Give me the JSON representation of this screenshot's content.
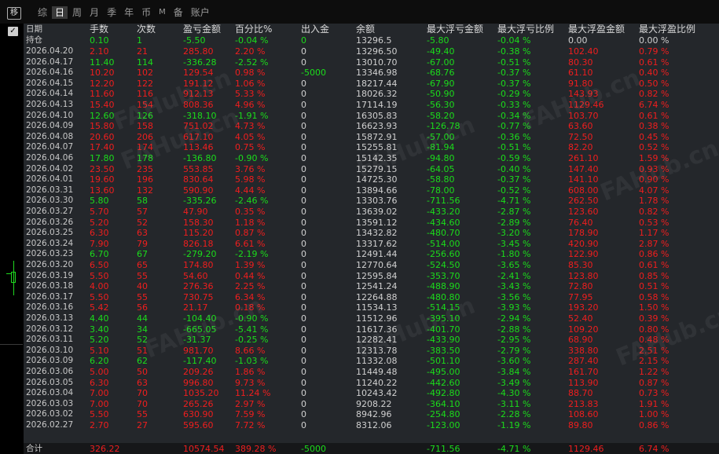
{
  "toolbar": {
    "move_icon": "移",
    "tabs": [
      "综",
      "日",
      "周",
      "月",
      "季",
      "年",
      "币",
      "M",
      "备",
      "账户"
    ],
    "active_tab": "日"
  },
  "colors": {
    "profit": "#f01e1e",
    "loss": "#1bdc1b",
    "neutral": "#d0d0d0"
  },
  "watermark": "FAHub.cn",
  "table": {
    "headers": [
      "日期",
      "手数",
      "次数",
      "盈亏金额",
      "百分比%",
      "出入金",
      "余额",
      "最大浮亏金额",
      "最大浮亏比例",
      "最大浮盈金额",
      "最大浮盈比例"
    ],
    "holding": {
      "label": "持仓",
      "v": [
        "0.10",
        "1",
        "-5.50",
        "-0.04 %",
        "0",
        "13296.5",
        "-5.80",
        "-0.04 %",
        "0.00",
        "0.00 %"
      ],
      "c": "gggggwggww"
    },
    "rows": [
      {
        "d": "2026.04.20",
        "v": [
          "2.10",
          "21",
          "285.80",
          "2.20 %",
          "0",
          "13296.50",
          "-49.40",
          "-0.38 %",
          "102.40",
          "0.79 %"
        ],
        "c": "rrrrwwggrr"
      },
      {
        "d": "2026.04.17",
        "v": [
          "11.40",
          "114",
          "-336.28",
          "-2.52 %",
          "0",
          "13010.70",
          "-67.00",
          "-0.51 %",
          "80.30",
          "0.61 %"
        ],
        "c": "ggggwwggrr"
      },
      {
        "d": "2026.04.16",
        "v": [
          "10.20",
          "102",
          "129.54",
          "0.98 %",
          "-5000",
          "13346.98",
          "-68.76",
          "-0.37 %",
          "61.10",
          "0.40 %"
        ],
        "c": "rrrrgwggrr"
      },
      {
        "d": "2026.04.15",
        "v": [
          "12.20",
          "122",
          "191.12",
          "1.06 %",
          "0",
          "18217.44",
          "-67.90",
          "-0.37 %",
          "91.80",
          "0.50 %"
        ],
        "c": "rrrrwwggrr"
      },
      {
        "d": "2026.04.14",
        "v": [
          "11.60",
          "116",
          "912.13",
          "5.33 %",
          "0",
          "18026.32",
          "-50.90",
          "-0.29 %",
          "143.93",
          "0.82 %"
        ],
        "c": "rrrrwwggrr"
      },
      {
        "d": "2026.04.13",
        "v": [
          "15.40",
          "154",
          "808.36",
          "4.96 %",
          "0",
          "17114.19",
          "-56.30",
          "-0.33 %",
          "1129.46",
          "6.74 %"
        ],
        "c": "rrrrwwggrr"
      },
      {
        "d": "2026.04.10",
        "v": [
          "12.60",
          "126",
          "-318.10",
          "-1.91 %",
          "0",
          "16305.83",
          "-58.20",
          "-0.34 %",
          "103.70",
          "0.61 %"
        ],
        "c": "ggggwwggrr"
      },
      {
        "d": "2026.04.09",
        "v": [
          "15.80",
          "158",
          "751.02",
          "4.73 %",
          "0",
          "16623.93",
          "-126.78",
          "-0.77 %",
          "63.60",
          "0.38 %"
        ],
        "c": "rrrrwwggrr"
      },
      {
        "d": "2026.04.08",
        "v": [
          "20.60",
          "206",
          "617.10",
          "4.05 %",
          "0",
          "15872.91",
          "-57.00",
          "-0.36 %",
          "72.50",
          "0.45 %"
        ],
        "c": "rrrrwwggrr"
      },
      {
        "d": "2026.04.07",
        "v": [
          "17.40",
          "174",
          "113.46",
          "0.75 %",
          "0",
          "15255.81",
          "-81.94",
          "-0.51 %",
          "82.20",
          "0.52 %"
        ],
        "c": "rrrrwwggrr"
      },
      {
        "d": "2026.04.06",
        "v": [
          "17.80",
          "178",
          "-136.80",
          "-0.90 %",
          "0",
          "15142.35",
          "-94.80",
          "-0.59 %",
          "261.10",
          "1.59 %"
        ],
        "c": "ggggwwggrr"
      },
      {
        "d": "2026.04.02",
        "v": [
          "23.50",
          "235",
          "553.85",
          "3.76 %",
          "0",
          "15279.15",
          "-64.05",
          "-0.40 %",
          "147.40",
          "0.93 %"
        ],
        "c": "rrrrwwggrr"
      },
      {
        "d": "2026.04.01",
        "v": [
          "19.60",
          "196",
          "830.64",
          "5.98 %",
          "0",
          "14725.30",
          "-58.80",
          "-0.37 %",
          "141.10",
          "0.90 %"
        ],
        "c": "rrrrwwggrr"
      },
      {
        "d": "2026.03.31",
        "v": [
          "13.60",
          "132",
          "590.90",
          "4.44 %",
          "0",
          "13894.66",
          "-78.00",
          "-0.52 %",
          "608.00",
          "4.07 %"
        ],
        "c": "rrrrwwggrr"
      },
      {
        "d": "2026.03.30",
        "v": [
          "5.80",
          "58",
          "-335.26",
          "-2.46 %",
          "0",
          "13303.76",
          "-711.56",
          "-4.71 %",
          "262.50",
          "1.78 %"
        ],
        "c": "ggggwwggrr"
      },
      {
        "d": "2026.03.27",
        "v": [
          "5.70",
          "57",
          "47.90",
          "0.35 %",
          "0",
          "13639.02",
          "-433.20",
          "-2.87 %",
          "123.60",
          "0.82 %"
        ],
        "c": "rrrrwwggrr"
      },
      {
        "d": "2026.03.26",
        "v": [
          "5.20",
          "52",
          "158.30",
          "1.18 %",
          "0",
          "13591.12",
          "-434.60",
          "-2.89 %",
          "76.40",
          "0.53 %"
        ],
        "c": "rrrrwwggrr"
      },
      {
        "d": "2026.03.25",
        "v": [
          "6.30",
          "63",
          "115.20",
          "0.87 %",
          "0",
          "13432.82",
          "-480.70",
          "-3.20 %",
          "178.90",
          "1.17 %"
        ],
        "c": "rrrrwwggrr"
      },
      {
        "d": "2026.03.24",
        "v": [
          "7.90",
          "79",
          "826.18",
          "6.61 %",
          "0",
          "13317.62",
          "-514.00",
          "-3.45 %",
          "420.90",
          "2.87 %"
        ],
        "c": "rrrrwwggrr"
      },
      {
        "d": "2026.03.23",
        "v": [
          "6.70",
          "67",
          "-279.20",
          "-2.19 %",
          "0",
          "12491.44",
          "-256.60",
          "-1.80 %",
          "122.90",
          "0.86 %"
        ],
        "c": "ggggwwggrr"
      },
      {
        "d": "2026.03.20",
        "v": [
          "6.50",
          "65",
          "174.80",
          "1.39 %",
          "0",
          "12770.64",
          "-524.50",
          "-3.65 %",
          "85.30",
          "0.61 %"
        ],
        "c": "rrrrwwggrr"
      },
      {
        "d": "2026.03.19",
        "v": [
          "5.50",
          "55",
          "54.60",
          "0.44 %",
          "0",
          "12595.84",
          "-353.70",
          "-2.41 %",
          "123.80",
          "0.85 %"
        ],
        "c": "rrrrwwggrr"
      },
      {
        "d": "2026.03.18",
        "v": [
          "4.00",
          "40",
          "276.36",
          "2.25 %",
          "0",
          "12541.24",
          "-488.90",
          "-3.43 %",
          "72.80",
          "0.51 %"
        ],
        "c": "rrrrwwggrr"
      },
      {
        "d": "2026.03.17",
        "v": [
          "5.50",
          "55",
          "730.75",
          "6.34 %",
          "0",
          "12264.88",
          "-480.80",
          "-3.56 %",
          "77.95",
          "0.58 %"
        ],
        "c": "rrrrwwggrr"
      },
      {
        "d": "2026.03.16",
        "v": [
          "5.42",
          "56",
          "21.17",
          "0.18 %",
          "0",
          "11534.13",
          "-514.15",
          "-3.93 %",
          "193.20",
          "1.50 %"
        ],
        "c": "rrrrwwggrr"
      },
      {
        "d": "2026.03.13",
        "v": [
          "4.40",
          "44",
          "-104.40",
          "-0.90 %",
          "0",
          "11512.96",
          "-395.10",
          "-2.94 %",
          "52.40",
          "0.39 %"
        ],
        "c": "ggggwwggrr"
      },
      {
        "d": "2026.03.12",
        "v": [
          "3.40",
          "34",
          "-665.05",
          "-5.41 %",
          "0",
          "11617.36",
          "-401.70",
          "-2.88 %",
          "109.20",
          "0.80 %"
        ],
        "c": "ggggwwggrr"
      },
      {
        "d": "2026.03.11",
        "v": [
          "5.20",
          "52",
          "-31.37",
          "-0.25 %",
          "0",
          "12282.41",
          "-433.90",
          "-2.95 %",
          "68.90",
          "0.48 %"
        ],
        "c": "ggggwwggrr"
      },
      {
        "d": "2026.03.10",
        "v": [
          "5.10",
          "51",
          "981.70",
          "8.66 %",
          "0",
          "12313.78",
          "-383.50",
          "-2.79 %",
          "338.80",
          "2.51 %"
        ],
        "c": "rrrrwwggrr"
      },
      {
        "d": "2026.03.09",
        "v": [
          "6.20",
          "62",
          "-117.40",
          "-1.03 %",
          "0",
          "11332.08",
          "-501.10",
          "-3.60 %",
          "287.40",
          "2.15 %"
        ],
        "c": "ggggwwggrr"
      },
      {
        "d": "2026.03.06",
        "v": [
          "5.00",
          "50",
          "209.26",
          "1.86 %",
          "0",
          "11449.48",
          "-495.00",
          "-3.84 %",
          "161.70",
          "1.22 %"
        ],
        "c": "rrrrwwggrr"
      },
      {
        "d": "2026.03.05",
        "v": [
          "6.30",
          "63",
          "996.80",
          "9.73 %",
          "0",
          "11240.22",
          "-442.60",
          "-3.49 %",
          "113.90",
          "0.87 %"
        ],
        "c": "rrrrwwggrr"
      },
      {
        "d": "2026.03.04",
        "v": [
          "7.00",
          "70",
          "1035.20",
          "11.24 %",
          "0",
          "10243.42",
          "-492.80",
          "-4.30 %",
          "88.70",
          "0.73 %"
        ],
        "c": "rrrrwwggrr"
      },
      {
        "d": "2026.03.03",
        "v": [
          "7.00",
          "70",
          "265.26",
          "2.97 %",
          "0",
          "9208.22",
          "-364.10",
          "-3.11 %",
          "213.83",
          "1.91 %"
        ],
        "c": "rrrrwwggrr"
      },
      {
        "d": "2026.03.02",
        "v": [
          "5.50",
          "55",
          "630.90",
          "7.59 %",
          "0",
          "8942.96",
          "-254.80",
          "-2.28 %",
          "108.60",
          "1.00 %"
        ],
        "c": "rrrrwwggrr"
      },
      {
        "d": "2026.02.27",
        "v": [
          "2.70",
          "27",
          "595.60",
          "7.72 %",
          "0",
          "8312.06",
          "-123.00",
          "-1.19 %",
          "89.80",
          "0.86 %"
        ],
        "c": "rrrrwwggrr"
      }
    ],
    "total": {
      "label": "合计",
      "v": [
        "326.22",
        "",
        "10574.54",
        "389.28 %",
        "-5000",
        "",
        "-711.56",
        "-4.71 %",
        "1129.46",
        "6.74 %"
      ],
      "c": "rrrrgwggrr"
    }
  }
}
